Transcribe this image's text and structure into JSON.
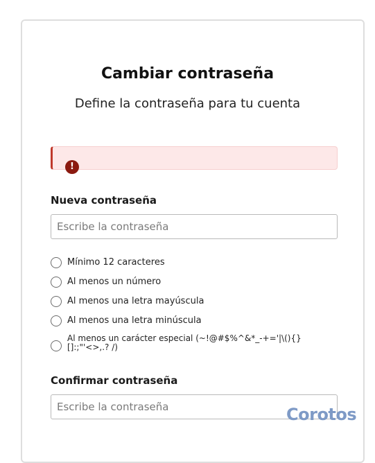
{
  "page": {
    "title": "Cambiar contraseña",
    "subtitle": "Define la contraseña para tu cuenta"
  },
  "alert": {
    "icon": "error-icon",
    "icon_glyph": "!"
  },
  "new_password": {
    "label": "Nueva contraseña",
    "placeholder": "Escribe la contraseña",
    "value": ""
  },
  "rules": [
    "Mínimo 12 caracteres",
    "Al menos un número",
    "Al menos una letra mayúscula",
    "Al menos una letra minúscula",
    "Al menos un carácter especial (~!@#$%^&*_-+='|\\(){}[]:;\"'<>,.? /)"
  ],
  "confirm_password": {
    "label": "Confirmar contraseña",
    "placeholder": "Escribe la contraseña",
    "value": ""
  },
  "brand": {
    "logo_text": "Corotos",
    "logo_color": "#7e9ac6"
  },
  "colors": {
    "alert_bg": "#fde8e8",
    "alert_border": "#c0392b",
    "error_icon": "#8b1a10"
  }
}
